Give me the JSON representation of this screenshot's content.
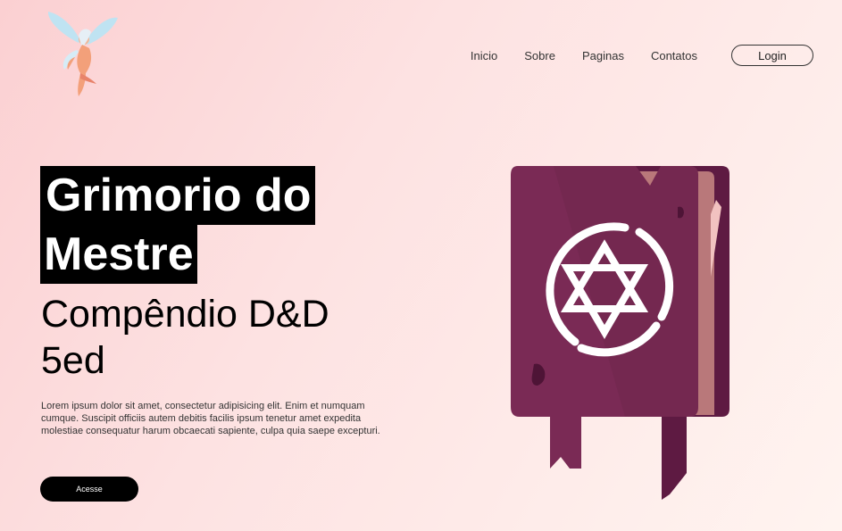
{
  "nav": {
    "items": [
      "Inicio",
      "Sobre",
      "Paginas",
      "Contatos"
    ],
    "login_label": "Login"
  },
  "hero": {
    "title_line1": "Grimorio do",
    "title_line2": "Mestre",
    "subtitle": "Compêndio D&D 5ed",
    "description": "Lorem ipsum dolor sit amet, consectetur adipisicing elit. Enim et numquam cumque. Suscipit officiis autem debitis facilis ipsum tenetur amet expedita molestiae consequatur harum obcaecati sapiente, culpa quia saepe excepturi.",
    "cta_label": "Acesse"
  },
  "colors": {
    "book_cover": "#7a2a55",
    "book_pages": "#b9787a",
    "ribbon": "#5e1a42",
    "background": "#fde2e2"
  },
  "icons": {
    "logo": "fairy-logo-icon",
    "hero_image": "spellbook-hexagram-icon"
  }
}
